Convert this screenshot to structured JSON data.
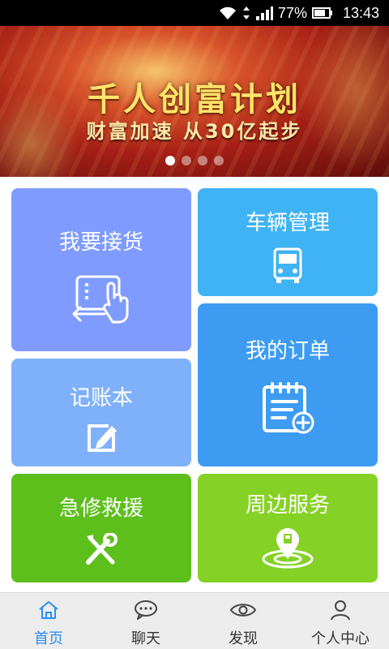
{
  "status_bar": {
    "battery": "77%",
    "time": "13:43"
  },
  "banner": {
    "title": "千人创富计划",
    "subtitle": "财富加速 从30亿起步",
    "slide_count": 4,
    "active_slide": 0
  },
  "tiles": {
    "receive": {
      "label": "我要接货",
      "icon": "tablet-touch-icon",
      "color": "#7f9bff"
    },
    "vehicle": {
      "label": "车辆管理",
      "icon": "truck-icon",
      "color": "#3fb3f3"
    },
    "orders": {
      "label": "我的订单",
      "icon": "order-add-icon",
      "color": "#3d9cf2"
    },
    "ledger": {
      "label": "记账本",
      "icon": "edit-icon",
      "color": "#7fb1fb"
    },
    "rescue": {
      "label": "急修救援",
      "icon": "tools-icon",
      "color": "#5dbf1c"
    },
    "nearby": {
      "label": "周边服务",
      "icon": "location-pin-icon",
      "color": "#86d126"
    }
  },
  "tabbar": {
    "active": "home",
    "items": [
      {
        "id": "home",
        "label": "首页",
        "icon": "home-icon"
      },
      {
        "id": "chat",
        "label": "聊天",
        "icon": "chat-icon"
      },
      {
        "id": "discover",
        "label": "发现",
        "icon": "eye-icon"
      },
      {
        "id": "profile",
        "label": "个人中心",
        "icon": "person-icon"
      }
    ]
  },
  "colors": {
    "accent": "#2a8ff0",
    "tabbar_bg": "#ececec"
  }
}
